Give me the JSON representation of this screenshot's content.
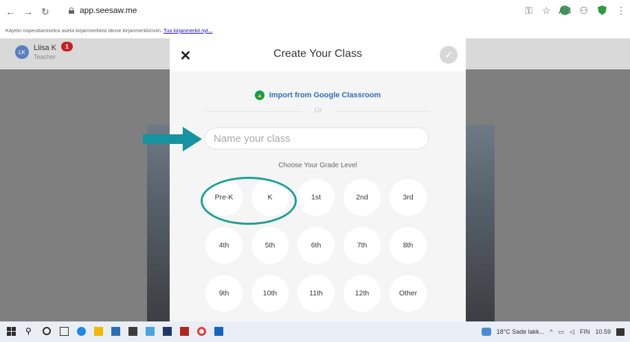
{
  "browser": {
    "url": "app.seesaw.me",
    "bookmark_hint": "Käytön nopeuttamiseksi aseta kirjanmerkkisi tänne kirjanmerkkiriviin.",
    "bookmark_link": "Tuo kirjanmerkit nyt..."
  },
  "user": {
    "initials": "LK",
    "name": "Liisa K",
    "role": "Teacher",
    "notification_count": "1"
  },
  "modal": {
    "title": "Create Your Class",
    "import_label": "Import from Google Classroom",
    "or_label": "Or",
    "class_name_placeholder": "Name your class",
    "class_name_value": "",
    "grade_prompt": "Choose Your Grade Level",
    "grades": [
      "Pre-K",
      "K",
      "1st",
      "2nd",
      "3rd",
      "4th",
      "5th",
      "6th",
      "7th",
      "8th",
      "9th",
      "10th",
      "11th",
      "12th",
      "Other"
    ]
  },
  "taskbar": {
    "weather": "18°C Sade lakk...",
    "language": "FIN",
    "time": "10.59"
  },
  "colors": {
    "annotation_accent": "#1aa195",
    "import_link": "#2f6fbf",
    "notification_badge": "#c52022"
  },
  "icons": [
    "back-icon",
    "forward-icon",
    "reload-icon",
    "lock-icon",
    "key-icon",
    "star-icon",
    "extension-icon",
    "profile-icon",
    "shield-icon",
    "menu-icon",
    "close-icon",
    "check-icon",
    "google-classroom-icon",
    "arrow-annotation-icon",
    "windows-start-icon",
    "search-icon",
    "cortana-icon",
    "task-view-icon",
    "edge-icon",
    "notification-icon"
  ]
}
